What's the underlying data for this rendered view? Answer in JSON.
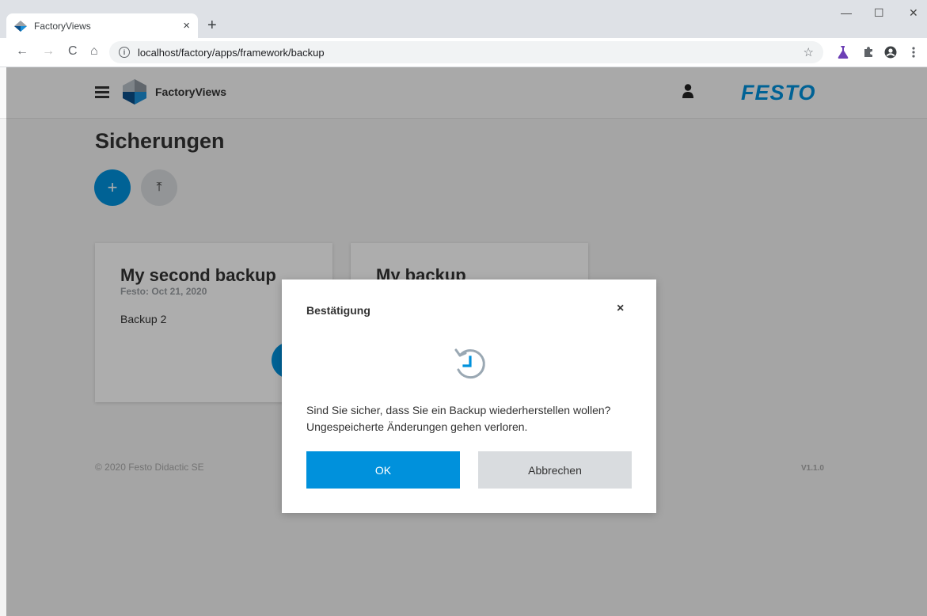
{
  "browser": {
    "tab_title": "FactoryViews",
    "tab_close": "×",
    "new_tab": "+",
    "url": "localhost/factory/apps/framework/backup",
    "window_controls": [
      "—",
      "☐",
      "✕"
    ],
    "nav": {
      "back": "←",
      "forward": "→",
      "reload": "C",
      "home": "⌂"
    },
    "star": "☆"
  },
  "app": {
    "name": "FactoryViews",
    "brand": "FESTO",
    "brand_color": "#0091dc"
  },
  "page": {
    "title": "Sicherungen",
    "add_button": "+",
    "upload_button": "⤒"
  },
  "cards": [
    {
      "title": "My second backup",
      "meta": "Festo: Oct 21, 2020",
      "description": "Backup 2"
    },
    {
      "title": "My backup"
    }
  ],
  "footer": {
    "copyright": "© 2020 Festo Didactic SE",
    "version": "V1.1.0"
  },
  "dialog": {
    "title": "Bestätigung",
    "close": "×",
    "icon": "restore-icon",
    "message_line1": "Sind Sie sicher, dass Sie ein Backup wiederherstellen wollen?",
    "message_line2": "Ungespeicherte Änderungen gehen verloren.",
    "ok_label": "OK",
    "cancel_label": "Abbrechen"
  }
}
